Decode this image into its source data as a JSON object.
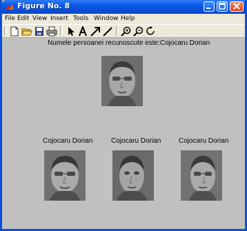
{
  "window": {
    "title": "Figure No. 8"
  },
  "menu": {
    "items": [
      "File",
      "Edit",
      "View",
      "Insert",
      "Tools",
      "Window",
      "Help"
    ]
  },
  "toolbar": {
    "icons": [
      "new-file-icon",
      "open-folder-icon",
      "save-icon",
      "print-icon",
      "pointer-icon",
      "text-icon",
      "arrow-icon",
      "line-icon",
      "zoom-in-icon",
      "zoom-out-icon",
      "rotate-icon"
    ]
  },
  "figure": {
    "heading": "Numele persoanei recunoscute este:Cojocaru Dorian",
    "captions": [
      "Cojocaru Dorian",
      "Cojocaru Dorian",
      "Cojocaru Dorian"
    ]
  },
  "colors": {
    "titlebar": "#0a58e6",
    "figure_background": "#c0c0c0",
    "menubar": "#ece9d8"
  }
}
